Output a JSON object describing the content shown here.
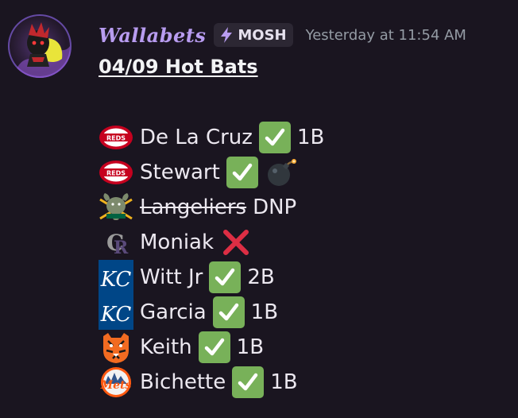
{
  "message": {
    "author": "Wallabets",
    "tag": {
      "label": "MOSH",
      "icon": "lightning-icon"
    },
    "timestamp": "Yesterday at 11:54 AM",
    "title": "04/09 Hot Bats"
  },
  "colors": {
    "username": "#b89cf0",
    "check_bg": "#78b159",
    "cross": "#dd2e44",
    "reds": "#c6011f",
    "royals": "#004687",
    "timestamp": "#949ba4"
  },
  "picks": [
    {
      "team_icon": "reds-logo-icon",
      "player": "De La Cruz",
      "status_icon": "check-mark-icon",
      "result": "1B"
    },
    {
      "team_icon": "reds-logo-icon",
      "player": "Stewart",
      "status_icon": "check-mark-icon",
      "extra_icon": "bomb-icon",
      "result": ""
    },
    {
      "team_icon": "athletics-logo-icon",
      "player": "Langeliers",
      "strikethrough": true,
      "result": "DNP"
    },
    {
      "team_icon": "rockies-logo-icon",
      "player": "Moniak",
      "status_icon": "cross-mark-icon",
      "result": ""
    },
    {
      "team_icon": "royals-logo-icon",
      "player": "Witt Jr",
      "status_icon": "check-mark-icon",
      "result": "2B"
    },
    {
      "team_icon": "royals-logo-icon",
      "player": "Garcia",
      "status_icon": "check-mark-icon",
      "result": "1B"
    },
    {
      "team_icon": "tigers-logo-icon",
      "player": "Keith",
      "status_icon": "check-mark-icon",
      "result": "1B"
    },
    {
      "team_icon": "mets-logo-icon",
      "player": "Bichette",
      "status_icon": "check-mark-icon",
      "result": "1B"
    }
  ]
}
